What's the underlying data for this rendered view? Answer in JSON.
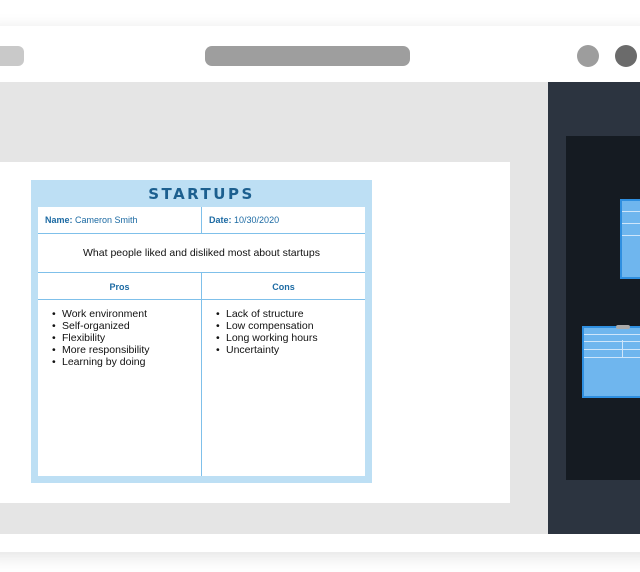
{
  "document": {
    "title": "STARTUPS",
    "name_label": "Name:",
    "name_value": "Cameron Smith",
    "date_label": "Date:",
    "date_value": "10/30/2020",
    "question": "What people liked and disliked most about startups",
    "pros_header": "Pros",
    "cons_header": "Cons",
    "pros": [
      "Work environment",
      "Self-organized",
      "Flexibility",
      "More responsibility",
      "Learning by doing"
    ],
    "cons": [
      "Lack of structure",
      "Low compensation",
      "Long working hours",
      "Uncertainty"
    ]
  },
  "colors": {
    "accent": "#1c5f8f",
    "frame": "#bddff4",
    "panel": "#2c3440",
    "thumbnail": "#6fb6ee"
  }
}
